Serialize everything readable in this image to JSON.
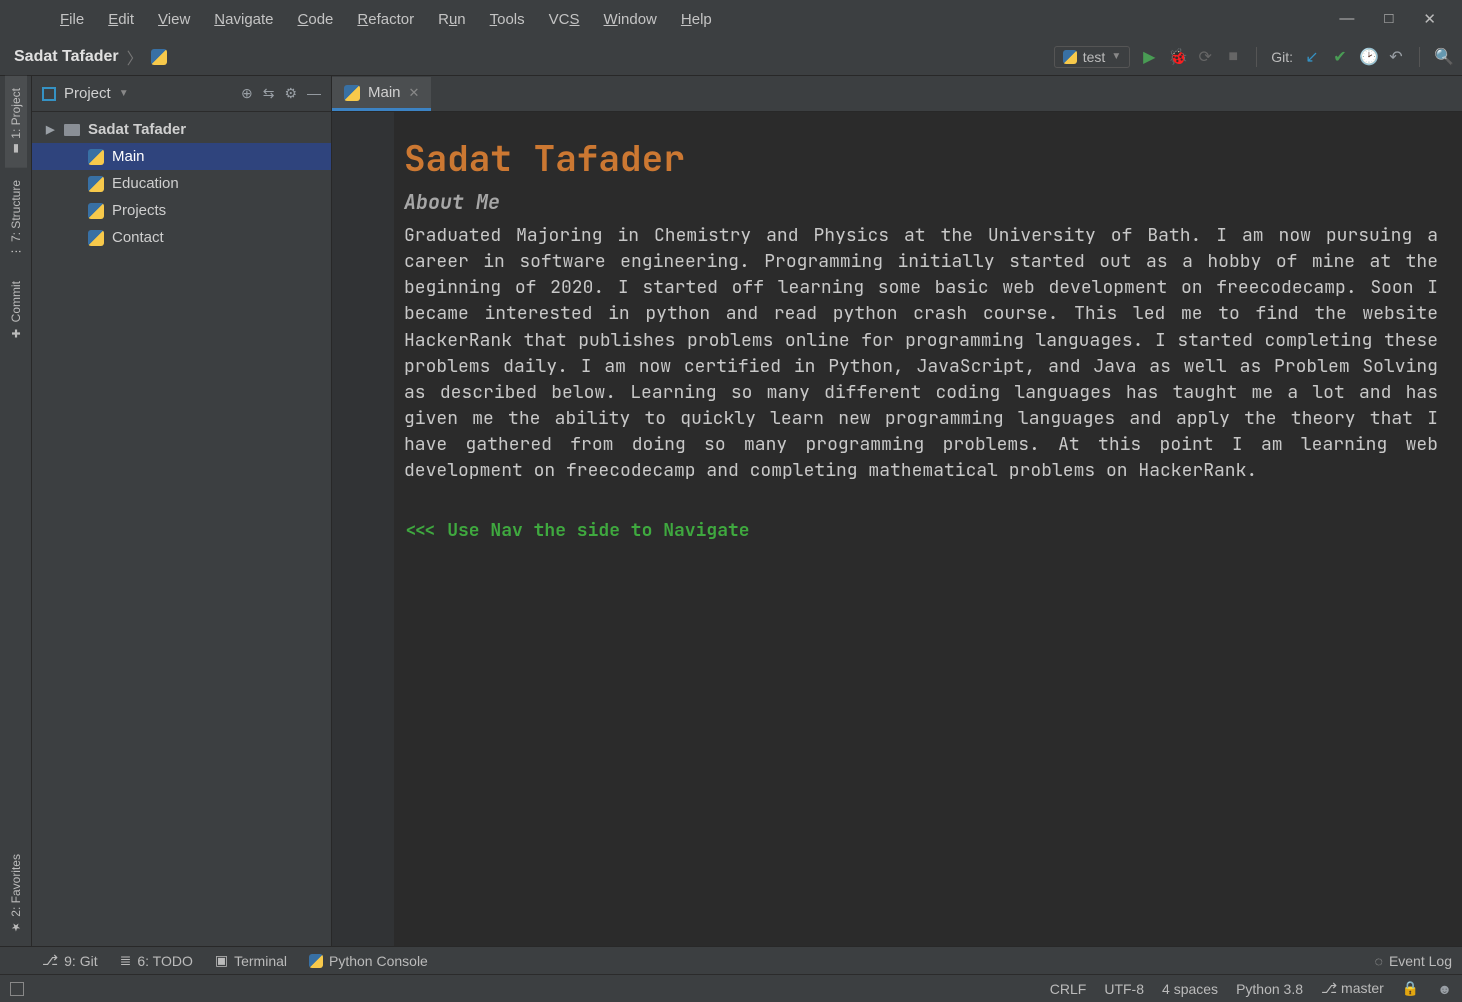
{
  "menu": {
    "items": [
      "File",
      "Edit",
      "View",
      "Navigate",
      "Code",
      "Refactor",
      "Run",
      "Tools",
      "VCS",
      "Window",
      "Help"
    ]
  },
  "windowControls": {
    "minimize": "—",
    "maximize": "□",
    "close": "✕"
  },
  "breadcrumb": {
    "project": "Sadat Tafader"
  },
  "runConfig": {
    "name": "test"
  },
  "toolbar": {
    "gitLabel": "Git:"
  },
  "leftTools": {
    "project": "1: Project",
    "structure": "7: Structure",
    "commit": "Commit",
    "favorites": "2: Favorites"
  },
  "projectPane": {
    "title": "Project",
    "tree": {
      "root": "Sadat Tafader",
      "children": [
        "Main",
        "Education",
        "Projects",
        "Contact"
      ],
      "selected": "Main"
    }
  },
  "editor": {
    "tab": "Main",
    "title": "Sadat Tafader",
    "subtitle": "About Me",
    "body": "Graduated Majoring in Chemistry and Physics at the University of Bath. I am now pursuing a career in software engineering. Programming initially started out as a hobby of mine at the beginning of 2020. I started off learning some basic web development on freecodecamp. Soon I became interested in python and read python crash course. This led me to find the website HackerRank that publishes problems online for programming languages. I started completing these problems daily. I am now certified in Python, JavaScript, and Java as well as Problem Solving as described below. Learning so many different coding languages has taught me a lot and has given me the ability to quickly learn new programming languages and apply the theory that I have gathered from doing so many programming problems. At this point I am learning web development on freecodecamp and completing mathematical problems on HackerRank.",
    "navHint": "<<< Use Nav the side to Navigate"
  },
  "bottomTools": {
    "git": "9: Git",
    "todo": "6: TODO",
    "terminal": "Terminal",
    "pyconsole": "Python Console",
    "eventLog": "Event Log"
  },
  "status": {
    "eol": "CRLF",
    "encoding": "UTF-8",
    "indent": "4 spaces",
    "interpreter": "Python 3.8",
    "branch": "master"
  }
}
